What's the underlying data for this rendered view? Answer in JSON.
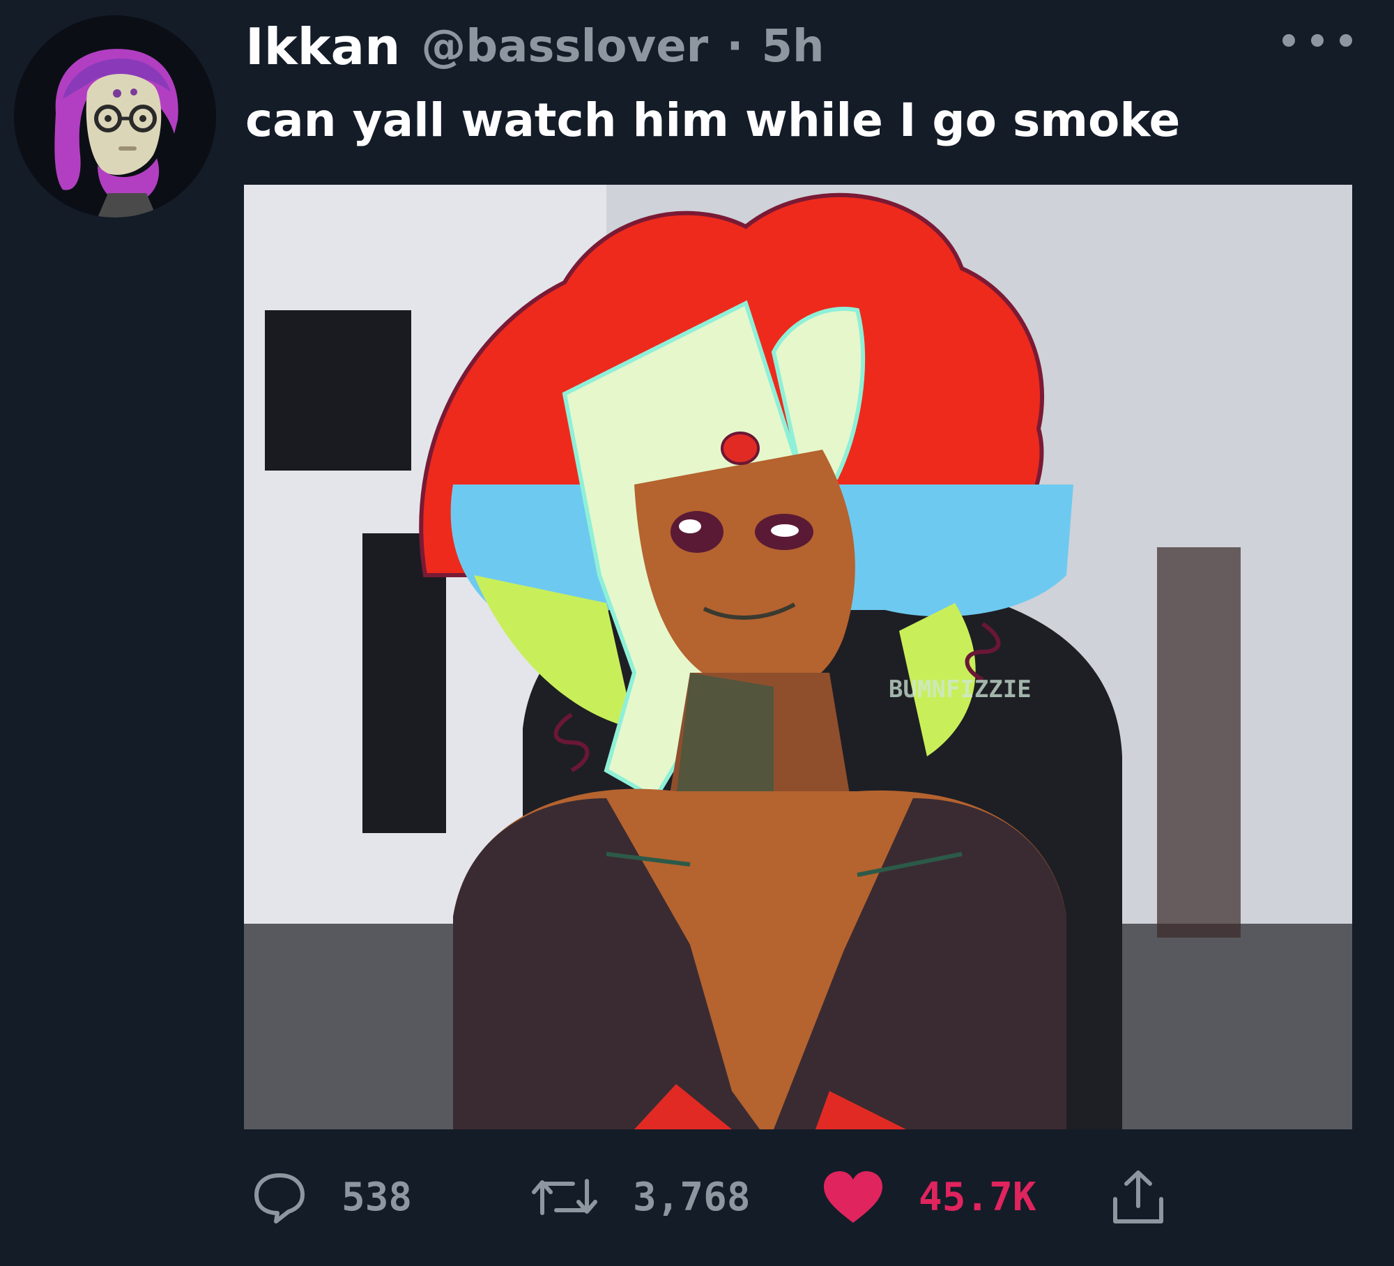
{
  "tweet": {
    "display_name": "Ikkan",
    "handle": "@basslover",
    "separator": "·",
    "time": "5h",
    "text": "can yall watch him while I go smoke"
  },
  "media": {
    "watermark": "BUMNFIZZIE"
  },
  "actions": {
    "reply_count": "538",
    "retweet_count": "3,768",
    "like_count": "45.7K"
  },
  "colors": {
    "background": "#141c28",
    "muted_text": "#8e969f",
    "like_accent": "#e0245e",
    "text": "#ffffff"
  },
  "icons": {
    "reply": "speech-bubble-icon",
    "retweet": "retweet-arrows-icon",
    "like": "heart-icon",
    "share": "share-upload-icon",
    "more": "more-dots-icon"
  }
}
